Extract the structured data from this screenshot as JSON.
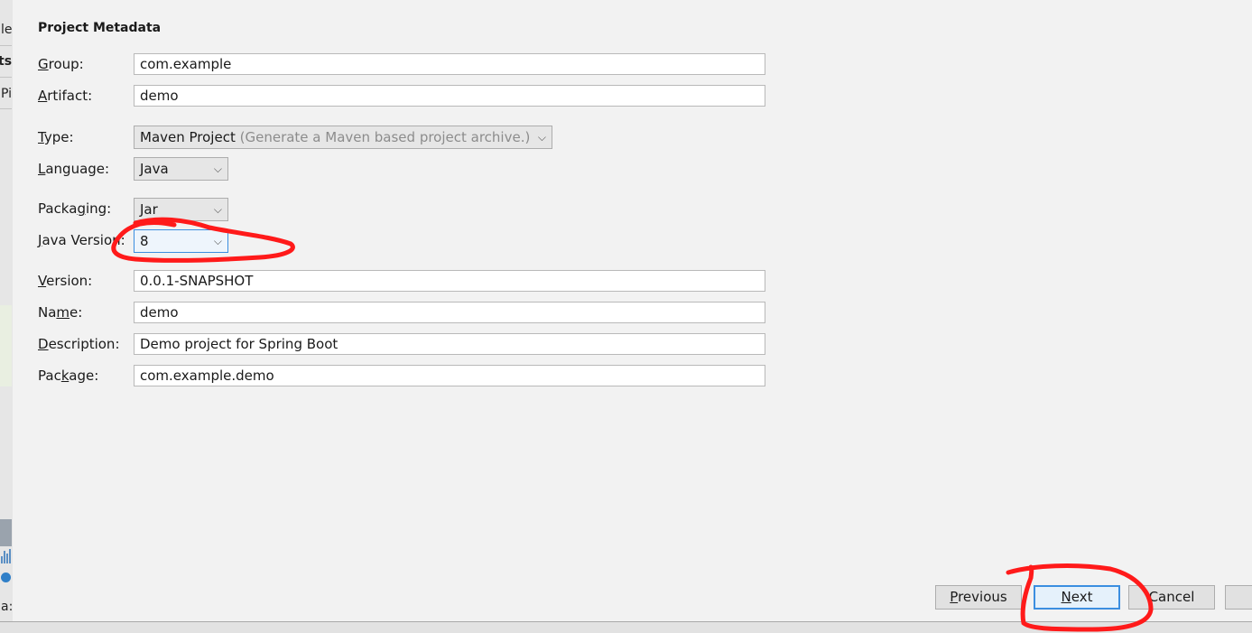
{
  "background": {
    "fragments": [
      "le",
      "tsp",
      "Pi",
      "a:"
    ]
  },
  "section_title": "Project Metadata",
  "form": {
    "group": {
      "label_pre": "",
      "label_u": "G",
      "label_post": "roup:",
      "value": "com.example"
    },
    "artifact": {
      "label_pre": "",
      "label_u": "A",
      "label_post": "rtifact:",
      "value": "demo"
    },
    "type": {
      "label_pre": "",
      "label_u": "T",
      "label_post": "ype:",
      "value": "Maven Project",
      "hint": "(Generate a Maven based project archive.)"
    },
    "language": {
      "label_pre": "",
      "label_u": "L",
      "label_post": "anguage:",
      "value": "Java"
    },
    "packaging": {
      "label_pre": "Packa",
      "label_u": "g",
      "label_post": "ing:",
      "value": "Jar"
    },
    "java_version": {
      "label_pre": "",
      "label_u": "J",
      "label_post": "ava Version:",
      "value": "8"
    },
    "version": {
      "label_pre": "",
      "label_u": "V",
      "label_post": "ersion:",
      "value": "0.0.1-SNAPSHOT"
    },
    "name": {
      "label_pre": "Na",
      "label_u": "m",
      "label_post": "e:",
      "value": "demo"
    },
    "description": {
      "label_pre": "",
      "label_u": "D",
      "label_post": "escription:",
      "value": "Demo project for Spring Boot"
    },
    "package": {
      "label_pre": "Pac",
      "label_u": "k",
      "label_post": "age:",
      "value": "com.example.demo"
    }
  },
  "buttons": {
    "previous": {
      "label_u": "P",
      "label_post": "revious"
    },
    "next": {
      "label_u": "N",
      "label_post": "ext"
    },
    "cancel": {
      "label": "Cancel"
    }
  },
  "colors": {
    "annotation": "#ff1a1a",
    "focus": "#3b8ee0",
    "dialog_bg": "#f2f2f2"
  }
}
